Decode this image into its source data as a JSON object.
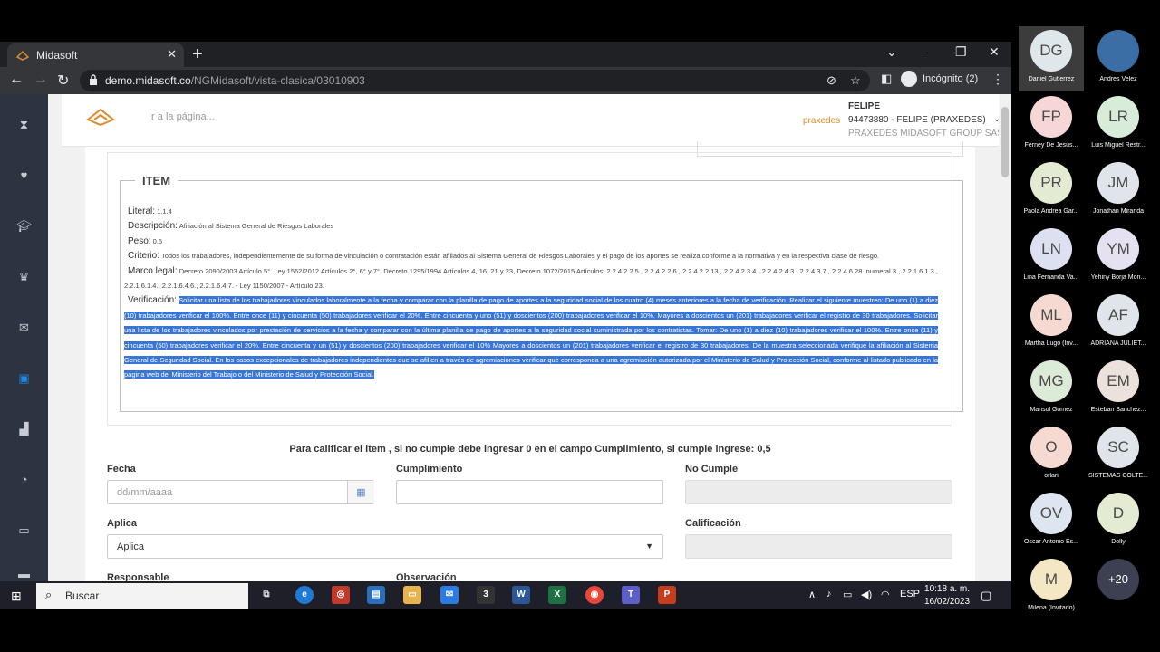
{
  "browser": {
    "tab_title": "Midasoft",
    "url_host": "demo.midasoft.co",
    "url_path": "/NGMidasoft/vista-clasica/03010903",
    "incognito_label": "Incógnito (2)"
  },
  "header": {
    "goto_placeholder": "Ir a la página...",
    "user_brand": "praxedes",
    "user_name": "FELIPE",
    "user_id": "94473880 - FELIPE (PRAXEDES)",
    "user_company": "PRAXEDES MIDASOFT GROUP SAS"
  },
  "item": {
    "legend": "ITEM",
    "literal_label": "Literal:",
    "literal_value": "1.1.4",
    "descripcion_label": "Descripción:",
    "descripcion_value": "Afiliación al Sistema General de Riesgos Laborales",
    "peso_label": "Peso:",
    "peso_value": "0.5",
    "criterio_label": "Criterio:",
    "criterio_value": "Todos los trabajadores, independientemente de su forma de vinculación o contratación están afiliados al Sistema General de Riesgos Laborales y el pago de los aportes se realiza conforme a la normativa y en la respectiva clase de riesgo.",
    "marco_label": "Marco legal:",
    "marco_value": "Decreto 2090/2003 Artículo 5°. Ley 1562/2012 Artículos 2°, 6° y 7°. Decreto 1295/1994 Artículos 4, 16, 21 y 23, Decreto 1072/2015 Artículos: 2.2.4.2.2.5., 2.2.4.2.2.6., 2.2.4.2.2.13., 2.2.4.2.3.4., 2.2.4.2.4.3., 2.2.4.3.7., 2.2.4.6.28. numeral 3., 2.2.1.6.1.3., 2.2.1.6.1.4., 2.2.1.6.4.6., 2.2.1.6.4.7. - Ley 1150/2007 - Artículo 23.",
    "verificacion_label": "Verificación:",
    "verificacion_value": "Solicitar una lista de los trabajadores vinculados laboralmente a la fecha y comparar con la planilla de pago de aportes a la seguridad social de los cuatro (4) meses anteriores a la fecha de verificación. Realizar el siguiente muestreo: De uno (1) a diez (10) trabajadores verificar el 100%. Entre once (11) y cincuenta (50) trabajadores verificar el 20%. Entre cincuenta y uno (51) y doscientos (200) trabajadores verificar el 10%. Mayores a doscientos un (201) trabajadores verificar el registro de 30 trabajadores. Solicitar una lista de los trabajadores vinculados por prestación de servicios a la fecha y comparar con la última planilla de pago de aportes a la seguridad social suministrada por los contratistas. Tomar: De uno (1) a diez (10) trabajadores verificar el 100%. Entre once (11) y cincuenta (50) trabajadores verificar el 20%. Entre cincuenta y un (51) y doscientos (200) trabajadores verificar el 10% Mayores a doscientos un (201) trabajadores verificar el registro de 30 trabajadores. De la muestra seleccionada verifique la afiliación al Sistema General de Seguridad Social. En los casos excepcionales de trabajadores independientes que se afilien a través de agremiaciones verificar que corresponda a una agremiación autorizada por el Ministerio de Salud y Protección Social, conforme al listado publicado en la página web del Ministerio del Trabajo o del Ministerio de Salud y Protección Social."
  },
  "form": {
    "instruction": "Para calificar el item , si no cumple debe ingresar 0 en el campo Cumplimiento, si cumple ingrese: 0,5",
    "fecha_label": "Fecha",
    "fecha_placeholder": "dd/mm/aaaa",
    "cumplimiento_label": "Cumplimiento",
    "nocumple_label": "No Cumple",
    "aplica_label": "Aplica",
    "aplica_value": "Aplica",
    "calificacion_label": "Calificación",
    "responsable_label": "Responsable",
    "observacion_label": "Observación"
  },
  "taskbar": {
    "search_label": "Buscar",
    "lang": "ESP",
    "time": "10:18 a. m.",
    "date": "16/02/2023"
  },
  "participants": [
    {
      "initials": "DG",
      "name": "Daniel Gutierrez",
      "color": "#dfe7ea"
    },
    {
      "initials": "",
      "name": "Andres Velez",
      "color": "#3a6ea5"
    },
    {
      "initials": "FP",
      "name": "Ferney De Jesus...",
      "color": "#f6d6d6"
    },
    {
      "initials": "LR",
      "name": "Luis Miguel Restr...",
      "color": "#d7ecd9"
    },
    {
      "initials": "PR",
      "name": "Paola Andrea Gar...",
      "color": "#e4ebd3"
    },
    {
      "initials": "JM",
      "name": "Jonathan Miranda",
      "color": "#dfe5ea"
    },
    {
      "initials": "LN",
      "name": "Lina Fernanda Va...",
      "color": "#dde0f0"
    },
    {
      "initials": "YM",
      "name": "Yehiny Borja Mon...",
      "color": "#e6e1f0"
    },
    {
      "initials": "ML",
      "name": "Martha Lugo (Inv...",
      "color": "#f6dad2"
    },
    {
      "initials": "AF",
      "name": "ADRIANA JULIET...",
      "color": "#dfe5ea"
    },
    {
      "initials": "MG",
      "name": "Marisol Gomez",
      "color": "#dcead8"
    },
    {
      "initials": "EM",
      "name": "Esteban Sanchez...",
      "color": "#ece2dc"
    },
    {
      "initials": "O",
      "name": "orlari",
      "color": "#f6dad2"
    },
    {
      "initials": "SC",
      "name": "SISTEMAS COLTE...",
      "color": "#dfe5ea"
    },
    {
      "initials": "OV",
      "name": "Oscar Antonio Es...",
      "color": "#dde5f0"
    },
    {
      "initials": "D",
      "name": "Dolly",
      "color": "#e4ebd3"
    },
    {
      "initials": "M",
      "name": "Milena (Invitado)",
      "color": "#f3e7c4"
    },
    {
      "initials": "+20",
      "name": "",
      "color": "#3d3f52"
    }
  ]
}
